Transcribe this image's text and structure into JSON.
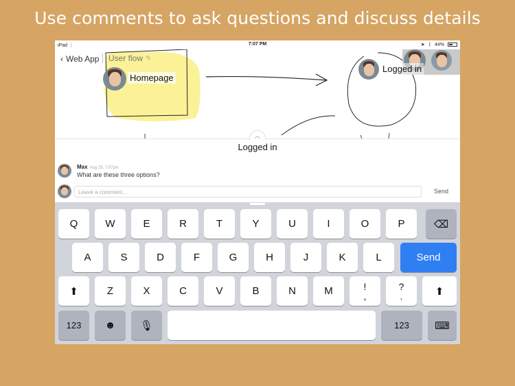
{
  "headline": "Use comments to ask questions and discuss details",
  "status": {
    "device": "iPad",
    "time": "7:07 PM",
    "battery": "44%"
  },
  "nav": {
    "back_label": "Web App",
    "flow_name": "User flow"
  },
  "canvas": {
    "nodes": [
      {
        "label": "Homepage"
      },
      {
        "label": "Logged in"
      }
    ]
  },
  "sheet": {
    "title": "Logged in"
  },
  "comment": {
    "author": "Max",
    "date": "Aug 25, 7:07pm",
    "text": "What are these three options?"
  },
  "compose": {
    "placeholder": "Leave a comment...",
    "send_label": "Send"
  },
  "keyboard": {
    "row1": [
      "Q",
      "W",
      "E",
      "R",
      "T",
      "Y",
      "U",
      "I",
      "O",
      "P"
    ],
    "row2": [
      "A",
      "S",
      "D",
      "F",
      "G",
      "H",
      "J",
      "K",
      "L"
    ],
    "send": "Send",
    "row3": [
      "Z",
      "X",
      "C",
      "V",
      "B",
      "N",
      "M"
    ],
    "punct1_top": "!",
    "punct1_bottom": ",",
    "punct2_top": "?",
    "punct2_bottom": ".",
    "numbers": "123"
  },
  "colors": {
    "background": "#d6a463",
    "send_key": "#2f7ff3",
    "highlight": "#fbf08c"
  }
}
